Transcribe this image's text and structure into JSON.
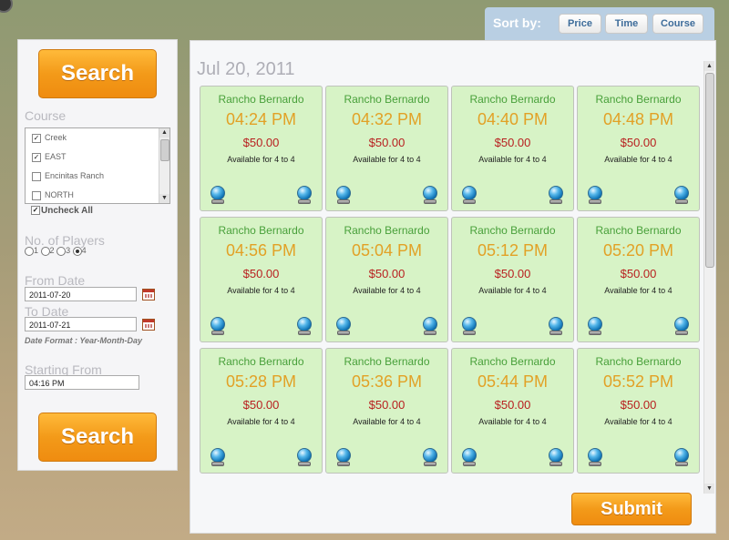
{
  "sort": {
    "label": "Sort by:",
    "buttons": [
      "Price",
      "Time",
      "Course"
    ]
  },
  "search": {
    "button_label": "Search",
    "course_label": "Course",
    "courses": [
      {
        "name": "Creek",
        "checked": true
      },
      {
        "name": "EAST",
        "checked": true
      },
      {
        "name": "Encinitas Ranch",
        "checked": false
      },
      {
        "name": "NORTH",
        "checked": false
      }
    ],
    "uncheck_all": "Uncheck All",
    "players_label": "No. of Players",
    "players_options": [
      "1",
      "2",
      "3",
      "4"
    ],
    "players_selected": "4",
    "from_date_label": "From Date",
    "from_date": "2011-07-20",
    "to_date_label": "To Date",
    "to_date": "2011-07-21",
    "date_format": "Date Format : Year-Month-Day",
    "starting_from_label": "Starting From",
    "starting_from": "04:16 PM"
  },
  "results": {
    "date_heading": "Jul 20, 2011",
    "slots": [
      {
        "course": "Rancho Bernardo",
        "time": "04:24 PM",
        "price": "$50.00",
        "availability": "Available for 4 to 4"
      },
      {
        "course": "Rancho Bernardo",
        "time": "04:32 PM",
        "price": "$50.00",
        "availability": "Available for 4 to 4"
      },
      {
        "course": "Rancho Bernardo",
        "time": "04:40 PM",
        "price": "$50.00",
        "availability": "Available for 4 to 4"
      },
      {
        "course": "Rancho Bernardo",
        "time": "04:48 PM",
        "price": "$50.00",
        "availability": "Available for 4 to 4"
      },
      {
        "course": "Rancho Bernardo",
        "time": "04:56 PM",
        "price": "$50.00",
        "availability": "Available for 4 to 4"
      },
      {
        "course": "Rancho Bernardo",
        "time": "05:04 PM",
        "price": "$50.00",
        "availability": "Available for 4 to 4"
      },
      {
        "course": "Rancho Bernardo",
        "time": "05:12 PM",
        "price": "$50.00",
        "availability": "Available for 4 to 4"
      },
      {
        "course": "Rancho Bernardo",
        "time": "05:20 PM",
        "price": "$50.00",
        "availability": "Available for 4 to 4"
      },
      {
        "course": "Rancho Bernardo",
        "time": "05:28 PM",
        "price": "$50.00",
        "availability": "Available for 4 to 4"
      },
      {
        "course": "Rancho Bernardo",
        "time": "05:36 PM",
        "price": "$50.00",
        "availability": "Available for 4 to 4"
      },
      {
        "course": "Rancho Bernardo",
        "time": "05:44 PM",
        "price": "$50.00",
        "availability": "Available for 4 to 4"
      },
      {
        "course": "Rancho Bernardo",
        "time": "05:52 PM",
        "price": "$50.00",
        "availability": "Available for 4 to 4"
      }
    ],
    "slot_icons": [
      "globe-icon",
      "globe-icon"
    ],
    "submit_label": "Submit"
  },
  "colors": {
    "accent_orange": "#f39a19",
    "slot_bg": "#d7f3c6",
    "course_green": "#48a03a",
    "time_gold": "#e2a126",
    "price_red": "#b81f1f",
    "sortbar_blue": "#b9cfe3"
  }
}
